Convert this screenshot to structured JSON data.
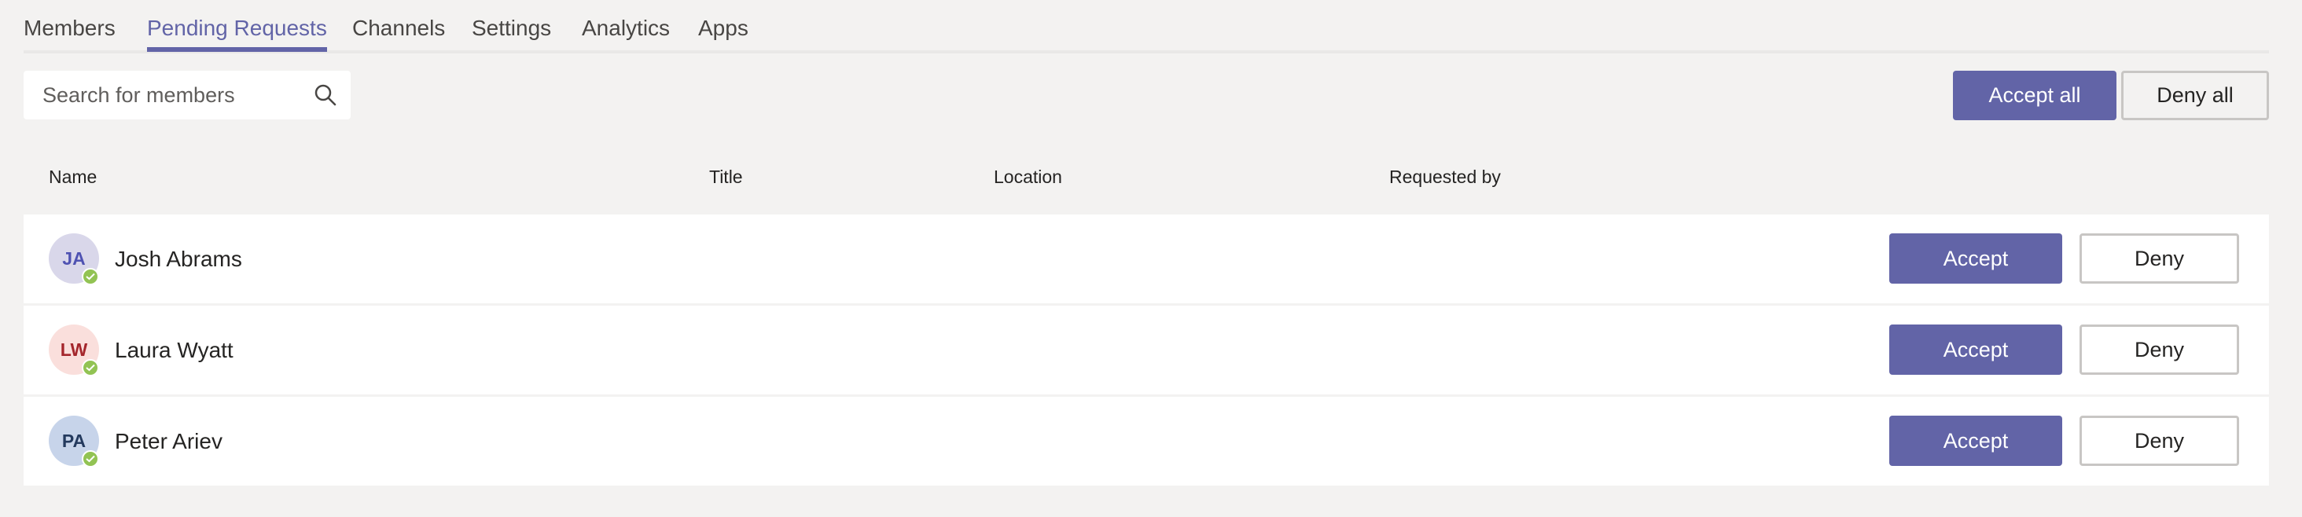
{
  "tabs": [
    {
      "label": "Members",
      "active": false
    },
    {
      "label": "Pending Requests",
      "active": true
    },
    {
      "label": "Channels",
      "active": false
    },
    {
      "label": "Settings",
      "active": false
    },
    {
      "label": "Analytics",
      "active": false
    },
    {
      "label": "Apps",
      "active": false
    }
  ],
  "search": {
    "placeholder": "Search for members",
    "icon": "search-icon"
  },
  "actions": {
    "accept_all": "Accept all",
    "deny_all": "Deny all"
  },
  "table": {
    "columns": [
      "Name",
      "Title",
      "Location",
      "Requested by"
    ],
    "rows": [
      {
        "initials": "JA",
        "name": "Josh Abrams",
        "avatar_bg": "#d9d7ea",
        "avatar_fg": "#4f52b2",
        "status": "available",
        "accept_label": "Accept",
        "deny_label": "Deny"
      },
      {
        "initials": "LW",
        "name": "Laura Wyatt",
        "avatar_bg": "#fadfdc",
        "avatar_fg": "#a4262c",
        "status": "available",
        "accept_label": "Accept",
        "deny_label": "Deny"
      },
      {
        "initials": "PA",
        "name": "Peter Ariev",
        "avatar_bg": "#c7d4ea",
        "avatar_fg": "#243a5e",
        "status": "available",
        "accept_label": "Accept",
        "deny_label": "Deny"
      }
    ]
  },
  "colors": {
    "accent": "#6264a7",
    "background": "#f3f2f1",
    "status_available": "#92c353"
  }
}
